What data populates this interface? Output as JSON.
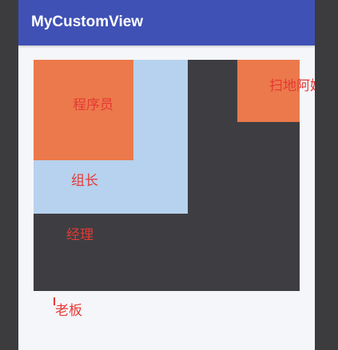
{
  "appbar": {
    "title": "MyCustomView"
  },
  "view": {
    "programmer_label": "程序员",
    "leader_label": "组长",
    "manager_label": "经理",
    "cleaner_label": "扫地阿姨",
    "boss_label": "老板"
  },
  "colors": {
    "appbar": "#3f51b5",
    "programmer": "#ec794b",
    "leader": "#b6d2ee",
    "boss": "#3e3e42",
    "label_text": "#e53935"
  }
}
